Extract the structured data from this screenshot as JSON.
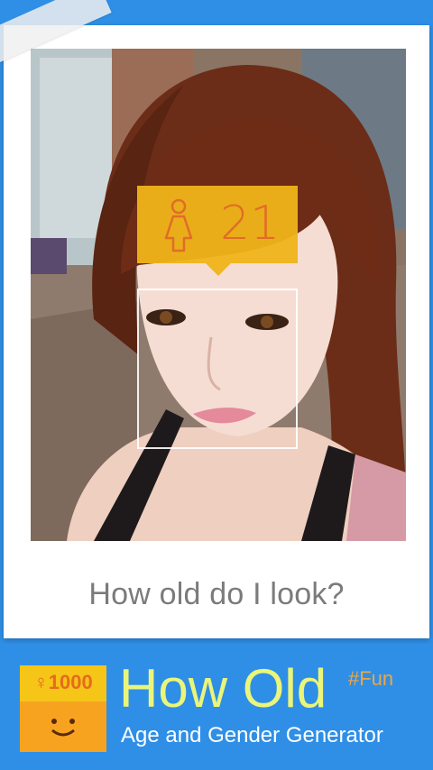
{
  "photo": {
    "age_badge": {
      "age": "21",
      "gender_icon": "female-figure-icon",
      "badge_color": "#f0b41a",
      "text_color": "#e8702a"
    },
    "caption": "How old do I look?"
  },
  "banner": {
    "app_icon": {
      "label": "♀1000",
      "icon": "smiley-face-icon"
    },
    "title": "How Old",
    "hashtag": "#Fun",
    "subtitle": "Age and Gender Generator",
    "background_color": "#2f8fe6",
    "title_color": "#eaf57a"
  }
}
